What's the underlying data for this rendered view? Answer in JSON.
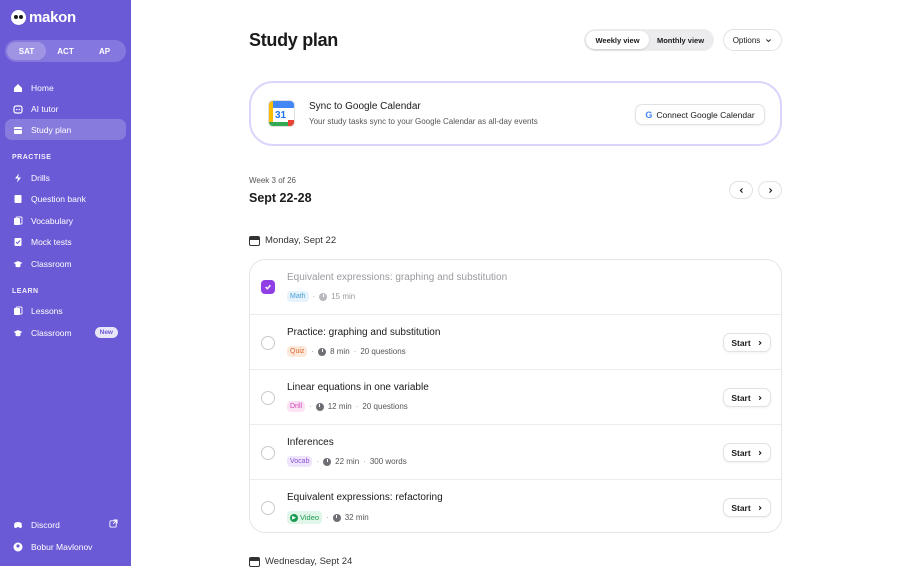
{
  "app": {
    "name": "makon"
  },
  "exam_tabs": [
    "SAT",
    "ACT",
    "AP"
  ],
  "nav": {
    "home": "Home",
    "ai_tutor": "AI tutor",
    "study_plan": "Study plan",
    "practise_header": "PRACTISE",
    "drills": "Drills",
    "question_bank": "Question bank",
    "vocabulary": "Vocabulary",
    "mock_tests": "Mock tests",
    "classroom": "Classroom",
    "learn_header": "LEARN",
    "lessons": "Lessons",
    "classroom2": "Classroom",
    "new_badge": "New",
    "discord": "Discord",
    "user": "Bobur Mavlonov"
  },
  "page": {
    "title": "Study plan",
    "weekly_view": "Weekly view",
    "monthly_view": "Monthly view",
    "options": "Options"
  },
  "sync": {
    "icon_day": "31",
    "title": "Sync to Google Calendar",
    "subtitle": "Your study tasks sync to your Google Calendar as all-day events",
    "button": "Connect Google Calendar",
    "button_icon": "G"
  },
  "week": {
    "label": "Week 3 of 26",
    "range": "Sept 22-28"
  },
  "days": [
    {
      "label": "Monday, Sept 22"
    },
    {
      "label": "Wednesday, Sept 24"
    }
  ],
  "tasks": [
    {
      "title": "Equivalent expressions: graphing and substitution",
      "tag": "Math",
      "duration": "15 min",
      "extra": "",
      "done": true
    },
    {
      "title": "Practice: graphing and substitution",
      "tag": "Quiz",
      "duration": "8 min",
      "extra": "20 questions",
      "done": false,
      "action": "Start"
    },
    {
      "title": "Linear equations in one variable",
      "tag": "Drill",
      "duration": "12 min",
      "extra": "20 questions",
      "done": false,
      "action": "Start"
    },
    {
      "title": "Inferences",
      "tag": "Vocab",
      "duration": "22 min",
      "extra": "300 words",
      "done": false,
      "action": "Start"
    },
    {
      "title": "Equivalent expressions: refactoring",
      "tag": "Video",
      "duration": "32 min",
      "extra": "",
      "done": false,
      "action": "Start"
    }
  ],
  "colors": {
    "sidebar": "#6a5ad6",
    "accent": "#8f3fe3",
    "sync_border": "#dcd5fb"
  },
  "icons": [
    "home-icon",
    "ai-tutor-icon",
    "calendar-icon",
    "bolt-icon",
    "question-bank-icon",
    "vocabulary-icon",
    "mock-tests-icon",
    "graduation-cap-icon",
    "lessons-icon",
    "discord-icon",
    "external-link-icon",
    "user-icon",
    "chevron-down-icon",
    "chevron-left-icon",
    "chevron-right-icon",
    "check-icon",
    "clock-icon",
    "play-icon"
  ]
}
